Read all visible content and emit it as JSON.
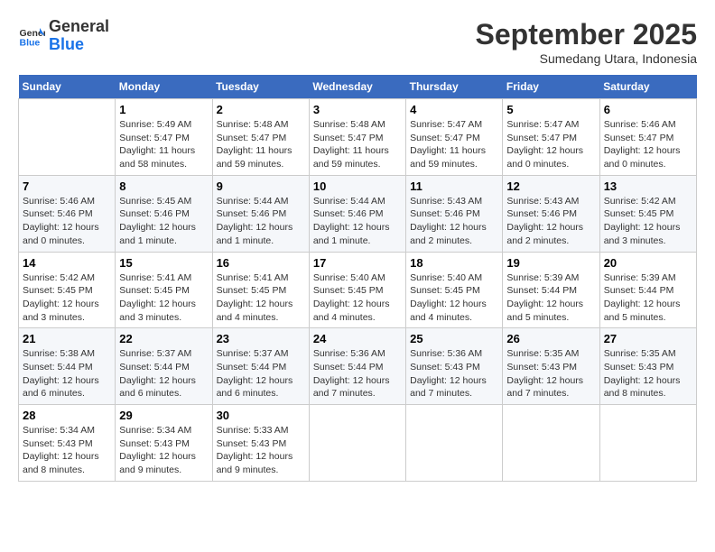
{
  "header": {
    "logo_line1": "General",
    "logo_line2": "Blue",
    "month": "September 2025",
    "location": "Sumedang Utara, Indonesia"
  },
  "weekdays": [
    "Sunday",
    "Monday",
    "Tuesday",
    "Wednesday",
    "Thursday",
    "Friday",
    "Saturday"
  ],
  "weeks": [
    [
      {
        "day": "",
        "info": ""
      },
      {
        "day": "1",
        "info": "Sunrise: 5:49 AM\nSunset: 5:47 PM\nDaylight: 11 hours\nand 58 minutes."
      },
      {
        "day": "2",
        "info": "Sunrise: 5:48 AM\nSunset: 5:47 PM\nDaylight: 11 hours\nand 59 minutes."
      },
      {
        "day": "3",
        "info": "Sunrise: 5:48 AM\nSunset: 5:47 PM\nDaylight: 11 hours\nand 59 minutes."
      },
      {
        "day": "4",
        "info": "Sunrise: 5:47 AM\nSunset: 5:47 PM\nDaylight: 11 hours\nand 59 minutes."
      },
      {
        "day": "5",
        "info": "Sunrise: 5:47 AM\nSunset: 5:47 PM\nDaylight: 12 hours\nand 0 minutes."
      },
      {
        "day": "6",
        "info": "Sunrise: 5:46 AM\nSunset: 5:47 PM\nDaylight: 12 hours\nand 0 minutes."
      }
    ],
    [
      {
        "day": "7",
        "info": "Sunrise: 5:46 AM\nSunset: 5:46 PM\nDaylight: 12 hours\nand 0 minutes."
      },
      {
        "day": "8",
        "info": "Sunrise: 5:45 AM\nSunset: 5:46 PM\nDaylight: 12 hours\nand 1 minute."
      },
      {
        "day": "9",
        "info": "Sunrise: 5:44 AM\nSunset: 5:46 PM\nDaylight: 12 hours\nand 1 minute."
      },
      {
        "day": "10",
        "info": "Sunrise: 5:44 AM\nSunset: 5:46 PM\nDaylight: 12 hours\nand 1 minute."
      },
      {
        "day": "11",
        "info": "Sunrise: 5:43 AM\nSunset: 5:46 PM\nDaylight: 12 hours\nand 2 minutes."
      },
      {
        "day": "12",
        "info": "Sunrise: 5:43 AM\nSunset: 5:46 PM\nDaylight: 12 hours\nand 2 minutes."
      },
      {
        "day": "13",
        "info": "Sunrise: 5:42 AM\nSunset: 5:45 PM\nDaylight: 12 hours\nand 3 minutes."
      }
    ],
    [
      {
        "day": "14",
        "info": "Sunrise: 5:42 AM\nSunset: 5:45 PM\nDaylight: 12 hours\nand 3 minutes."
      },
      {
        "day": "15",
        "info": "Sunrise: 5:41 AM\nSunset: 5:45 PM\nDaylight: 12 hours\nand 3 minutes."
      },
      {
        "day": "16",
        "info": "Sunrise: 5:41 AM\nSunset: 5:45 PM\nDaylight: 12 hours\nand 4 minutes."
      },
      {
        "day": "17",
        "info": "Sunrise: 5:40 AM\nSunset: 5:45 PM\nDaylight: 12 hours\nand 4 minutes."
      },
      {
        "day": "18",
        "info": "Sunrise: 5:40 AM\nSunset: 5:45 PM\nDaylight: 12 hours\nand 4 minutes."
      },
      {
        "day": "19",
        "info": "Sunrise: 5:39 AM\nSunset: 5:44 PM\nDaylight: 12 hours\nand 5 minutes."
      },
      {
        "day": "20",
        "info": "Sunrise: 5:39 AM\nSunset: 5:44 PM\nDaylight: 12 hours\nand 5 minutes."
      }
    ],
    [
      {
        "day": "21",
        "info": "Sunrise: 5:38 AM\nSunset: 5:44 PM\nDaylight: 12 hours\nand 6 minutes."
      },
      {
        "day": "22",
        "info": "Sunrise: 5:37 AM\nSunset: 5:44 PM\nDaylight: 12 hours\nand 6 minutes."
      },
      {
        "day": "23",
        "info": "Sunrise: 5:37 AM\nSunset: 5:44 PM\nDaylight: 12 hours\nand 6 minutes."
      },
      {
        "day": "24",
        "info": "Sunrise: 5:36 AM\nSunset: 5:44 PM\nDaylight: 12 hours\nand 7 minutes."
      },
      {
        "day": "25",
        "info": "Sunrise: 5:36 AM\nSunset: 5:43 PM\nDaylight: 12 hours\nand 7 minutes."
      },
      {
        "day": "26",
        "info": "Sunrise: 5:35 AM\nSunset: 5:43 PM\nDaylight: 12 hours\nand 7 minutes."
      },
      {
        "day": "27",
        "info": "Sunrise: 5:35 AM\nSunset: 5:43 PM\nDaylight: 12 hours\nand 8 minutes."
      }
    ],
    [
      {
        "day": "28",
        "info": "Sunrise: 5:34 AM\nSunset: 5:43 PM\nDaylight: 12 hours\nand 8 minutes."
      },
      {
        "day": "29",
        "info": "Sunrise: 5:34 AM\nSunset: 5:43 PM\nDaylight: 12 hours\nand 9 minutes."
      },
      {
        "day": "30",
        "info": "Sunrise: 5:33 AM\nSunset: 5:43 PM\nDaylight: 12 hours\nand 9 minutes."
      },
      {
        "day": "",
        "info": ""
      },
      {
        "day": "",
        "info": ""
      },
      {
        "day": "",
        "info": ""
      },
      {
        "day": "",
        "info": ""
      }
    ]
  ]
}
